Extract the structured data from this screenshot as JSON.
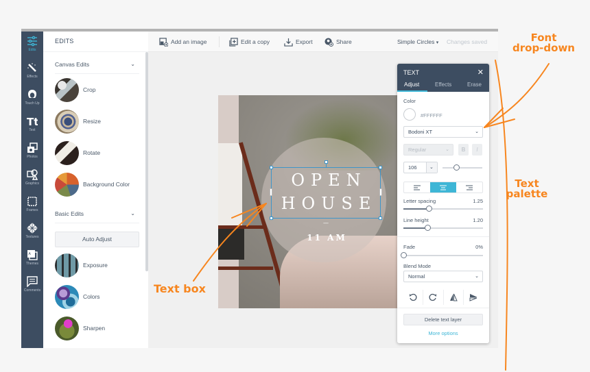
{
  "rail": {
    "items": [
      {
        "label": "Edits",
        "icon": "sliders-icon",
        "active": true
      },
      {
        "label": "Effects",
        "icon": "magic-wand-icon"
      },
      {
        "label": "Touch Up",
        "icon": "face-icon"
      },
      {
        "label": "Text",
        "icon": "text-tt-icon"
      },
      {
        "label": "Photos",
        "icon": "photos-icon"
      },
      {
        "label": "Graphics",
        "icon": "shapes-icon"
      },
      {
        "label": "Frames",
        "icon": "frame-icon"
      },
      {
        "label": "Textures",
        "icon": "texture-icon"
      },
      {
        "label": "Themes",
        "icon": "themes-icon"
      },
      {
        "label": "Comments",
        "icon": "comment-icon"
      }
    ]
  },
  "edits": {
    "title": "EDITS",
    "canvas_section": "Canvas Edits",
    "canvas_tools": [
      "Crop",
      "Resize",
      "Rotate",
      "Background Color"
    ],
    "basic_section": "Basic Edits",
    "auto_adjust": "Auto Adjust",
    "basic_tools": [
      "Exposure",
      "Colors",
      "Sharpen"
    ]
  },
  "toolbar": {
    "add_image": "Add an image",
    "edit_copy": "Edit a copy",
    "export": "Export",
    "share": "Share",
    "template": "Simple Circles",
    "status": "Changes saved"
  },
  "canvas": {
    "line1": "OPEN",
    "line2": "HOUSE",
    "dash": "—",
    "line3": "11 AM"
  },
  "palette": {
    "title": "TEXT",
    "close": "✕",
    "tabs": [
      "Adjust",
      "Effects",
      "Erase"
    ],
    "active_tab": "Adjust",
    "color_label": "Color",
    "color_value": "#FFFFFF",
    "font": "Bodoni XT",
    "weight": "Regular",
    "bold": "B",
    "italic": "I",
    "size": "106",
    "size_slider_fraction": 0.35,
    "alignment": "center",
    "letter_spacing_label": "Letter spacing",
    "letter_spacing": "1.25",
    "letter_spacing_fraction": 0.32,
    "line_height_label": "Line height",
    "line_height": "1.20",
    "line_height_fraction": 0.3,
    "fade_label": "Fade",
    "fade": "0%",
    "fade_fraction": 0,
    "blend_label": "Blend Mode",
    "blend": "Normal",
    "delete": "Delete text layer",
    "more": "More options"
  },
  "annotations": {
    "font_dropdown": [
      "Font",
      "drop-down"
    ],
    "text_palette": [
      "Text",
      "palette"
    ],
    "text_box": "Text box",
    "color": "#f7861f"
  },
  "colors": {
    "rail_bg": "#3d4d61",
    "accent": "#3eb6d6",
    "selection": "#3e95c9"
  }
}
